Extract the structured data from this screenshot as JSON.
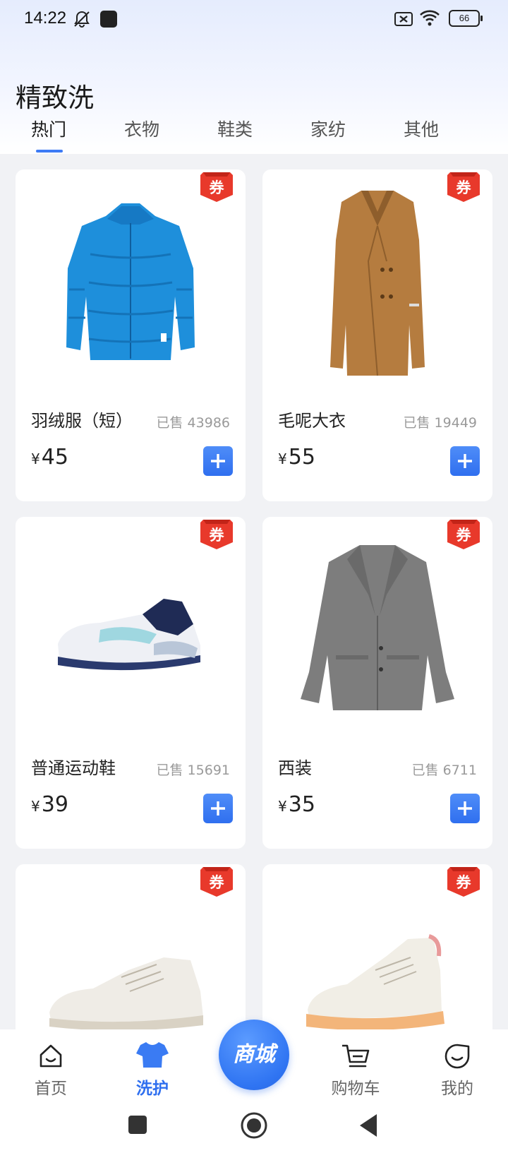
{
  "status_bar": {
    "time": "14:22",
    "battery": "66"
  },
  "page": {
    "title": "精致洗"
  },
  "tabs": [
    {
      "label": "热门"
    },
    {
      "label": "衣物"
    },
    {
      "label": "鞋类"
    },
    {
      "label": "家纺"
    },
    {
      "label": "其他"
    }
  ],
  "active_tab": "热门",
  "products": [
    {
      "name": "羽绒服（短）",
      "sold": "已售 43986",
      "currency": "¥",
      "price": "45",
      "coupon": "券",
      "image": "blue-puffer-jacket"
    },
    {
      "name": "毛呢大衣",
      "sold": "已售 19449",
      "currency": "¥",
      "price": "55",
      "coupon": "券",
      "image": "camel-wool-coat"
    },
    {
      "name": "普通运动鞋",
      "sold": "已售 15691",
      "currency": "¥",
      "price": "39",
      "coupon": "券",
      "image": "sneaker"
    },
    {
      "name": "西装",
      "sold": "已售 6711",
      "currency": "¥",
      "price": "35",
      "coupon": "券",
      "image": "grey-blazer"
    },
    {
      "name": "",
      "sold": "",
      "currency": "",
      "price": "",
      "coupon": "券",
      "image": "white-leather-sneaker"
    },
    {
      "name": "",
      "sold": "",
      "currency": "",
      "price": "",
      "coupon": "券",
      "image": "canvas-high-top"
    }
  ],
  "bottom_nav": {
    "home": "首页",
    "wash": "洗护",
    "mall": "商城",
    "cart": "购物车",
    "mine": "我的"
  },
  "colors": {
    "accent": "#2f6fef",
    "coupon": "#e8392b",
    "background": "#f1f2f5"
  }
}
